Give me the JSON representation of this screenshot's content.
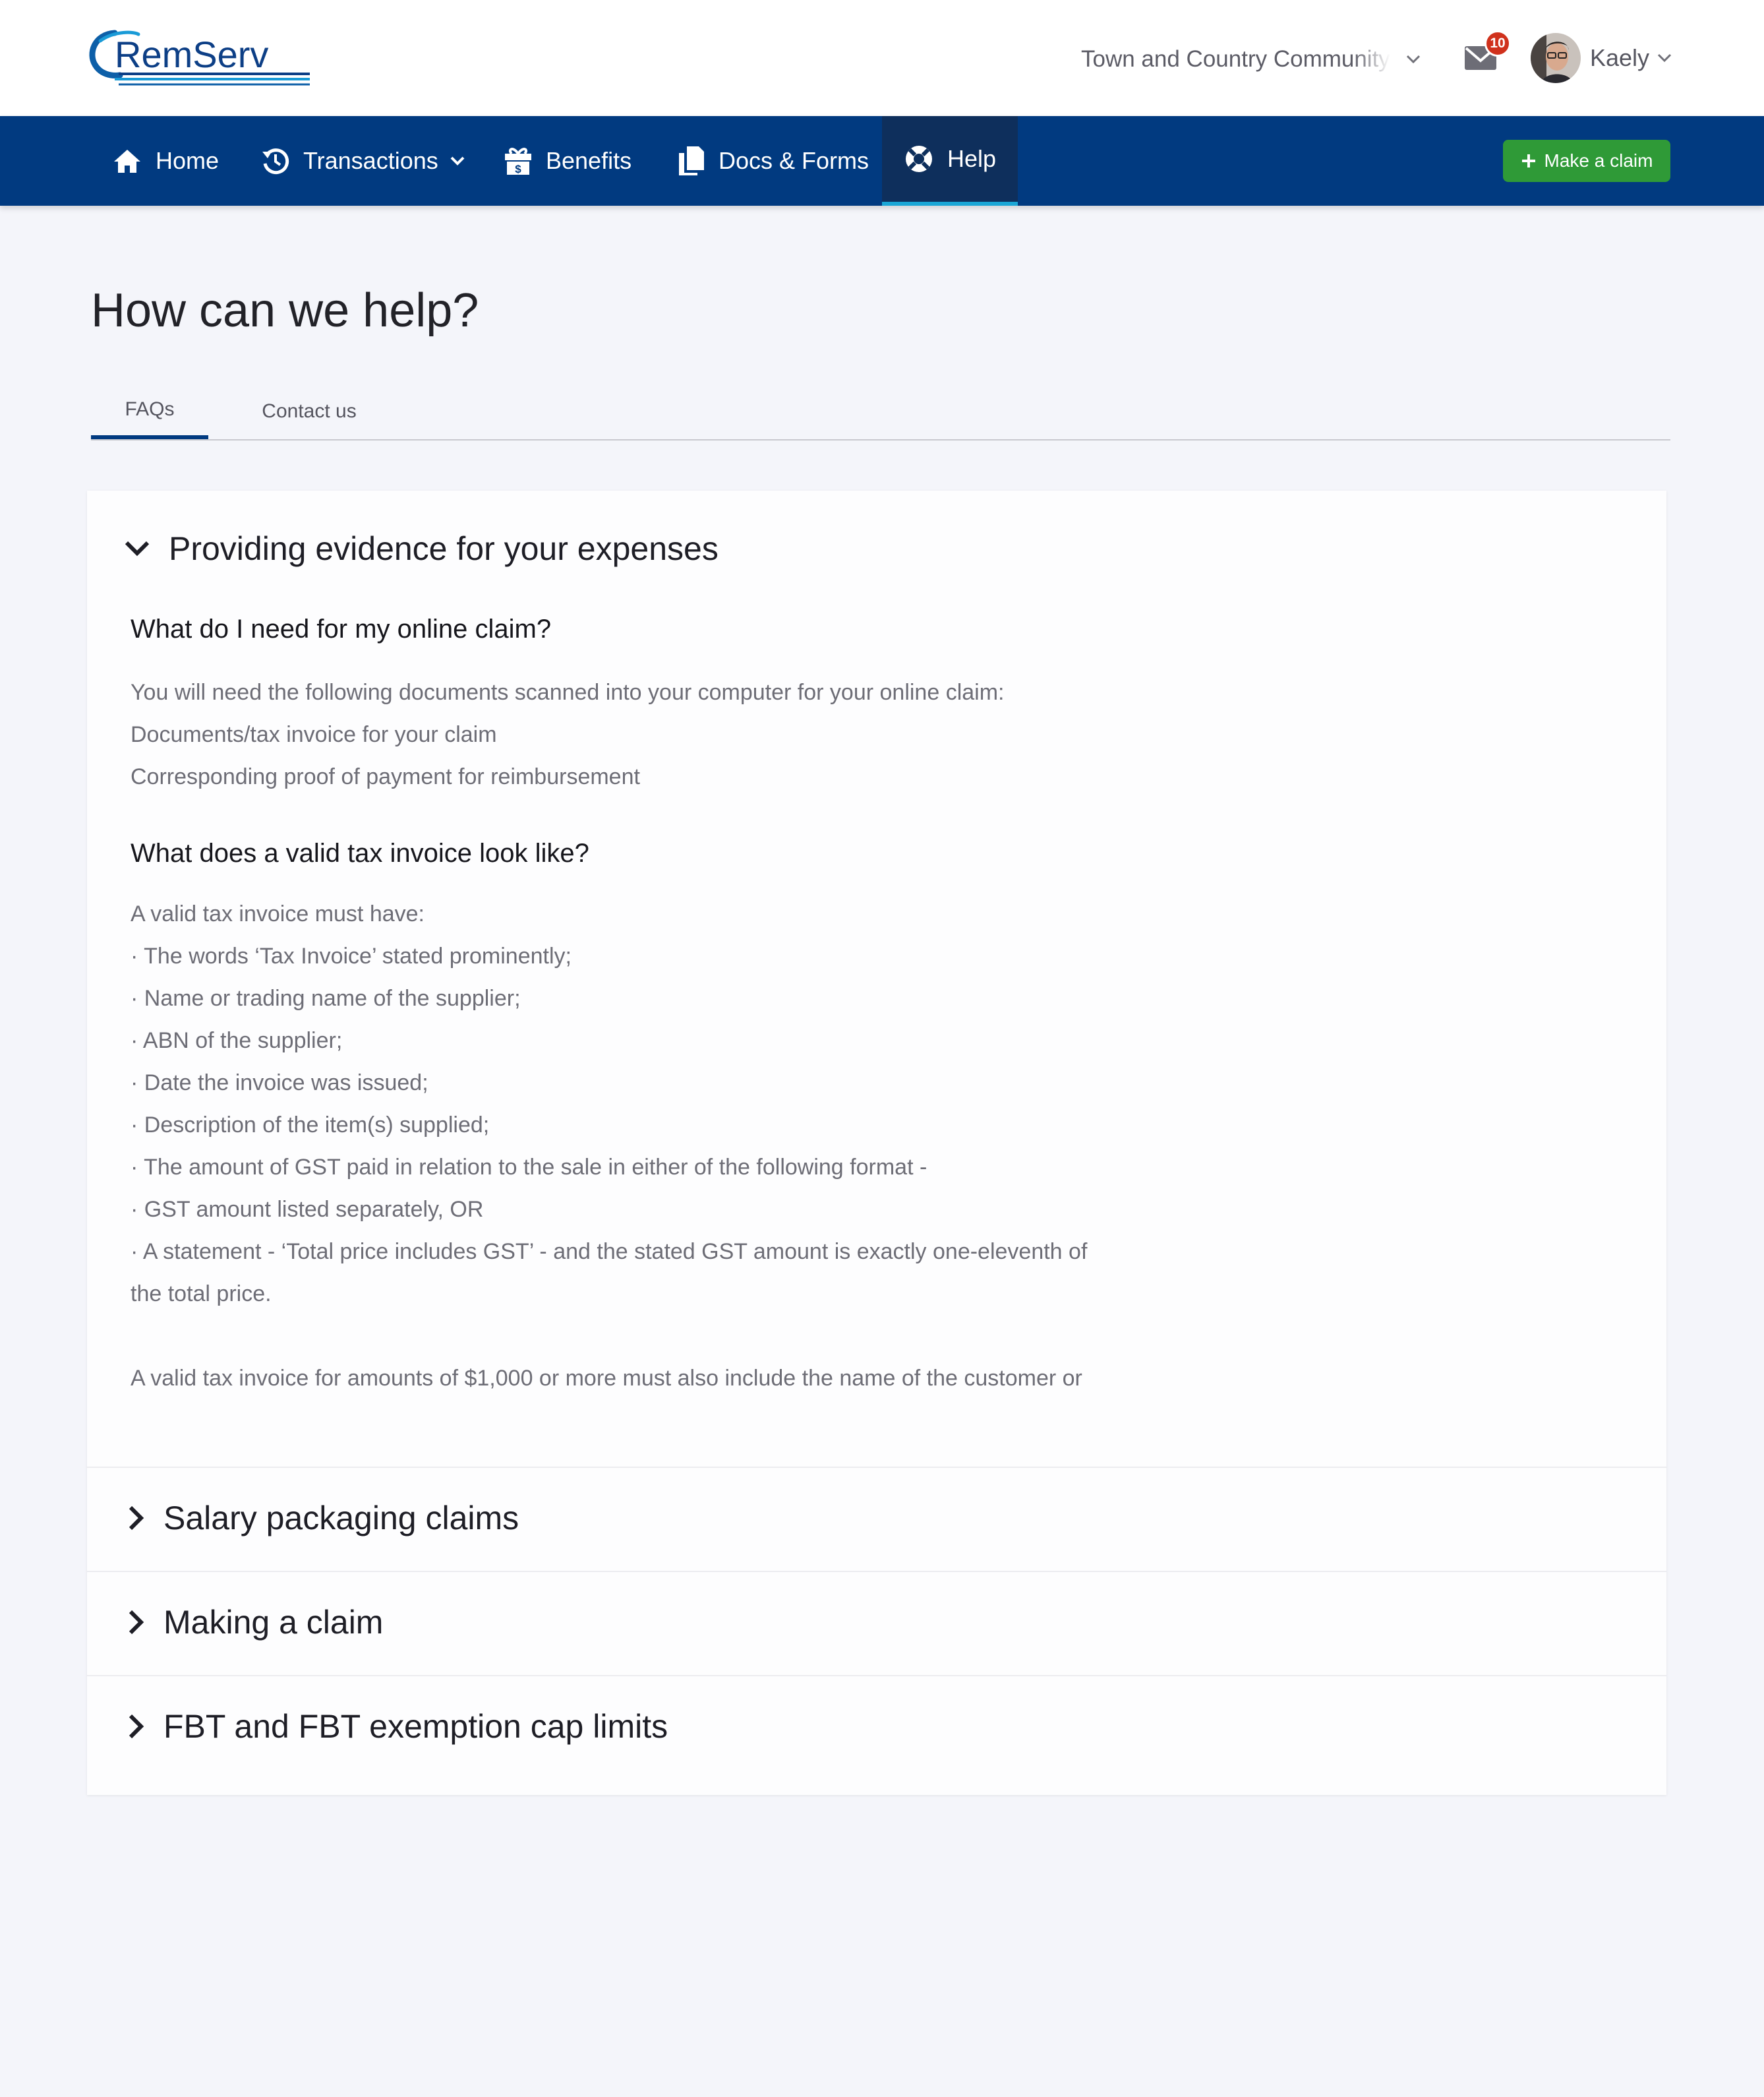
{
  "brand": {
    "logo_text": "RemServ"
  },
  "header": {
    "organisation": "Town and Country Community",
    "mail_badge": "10",
    "user_name": "Kaely"
  },
  "nav": {
    "items": [
      {
        "label": "Home",
        "icon": "home-icon"
      },
      {
        "label": "Transactions",
        "icon": "history-icon"
      },
      {
        "label": "Benefits",
        "icon": "gift-dollar-icon"
      },
      {
        "label": "Docs & Forms",
        "icon": "documents-icon"
      },
      {
        "label": "Help",
        "icon": "lifebuoy-icon",
        "active": true
      }
    ],
    "claim_button": "Make a claim"
  },
  "page": {
    "title": "How can we help?",
    "tabs": [
      {
        "label": "FAQs",
        "active": true
      },
      {
        "label": "Contact us"
      }
    ]
  },
  "faq": {
    "open_section": {
      "title": "Providing evidence for your expenses",
      "q1": {
        "heading": "What do I need for my online claim?",
        "lines": [
          "You will need the following documents scanned into your computer for your online claim:",
          "Documents/tax invoice for your claim",
          "Corresponding proof of payment for reimbursement"
        ]
      },
      "q2": {
        "heading": "What does a valid tax invoice look like?",
        "lines": [
          "A valid tax invoice must have:",
          "· The words ‘Tax Invoice’ stated prominently;",
          "· Name or trading name of the supplier;",
          "· ABN of the supplier;",
          "· Date the invoice was issued;",
          "· Description of the item(s) supplied;",
          "· The amount of GST paid in relation to the sale in either of the following format -",
          "· GST amount listed separately, OR",
          "· A statement - ‘Total price includes GST’ - and the stated GST amount is exactly one-eleventh of",
          "the total price."
        ],
        "extra": "A valid tax invoice for amounts of $1,000 or more must also include the name of the customer or"
      }
    },
    "collapsed_sections": [
      "Salary packaging claims",
      "Making a claim",
      "FBT and FBT exemption cap limits"
    ]
  },
  "colors": {
    "nav_bg": "#013a80",
    "nav_active_bg": "#0e2f5c",
    "nav_active_indicator": "#1aa6d6",
    "claim_button": "#2f9a37",
    "badge": "#d0311c",
    "page_bg": "#f4f5fa"
  }
}
